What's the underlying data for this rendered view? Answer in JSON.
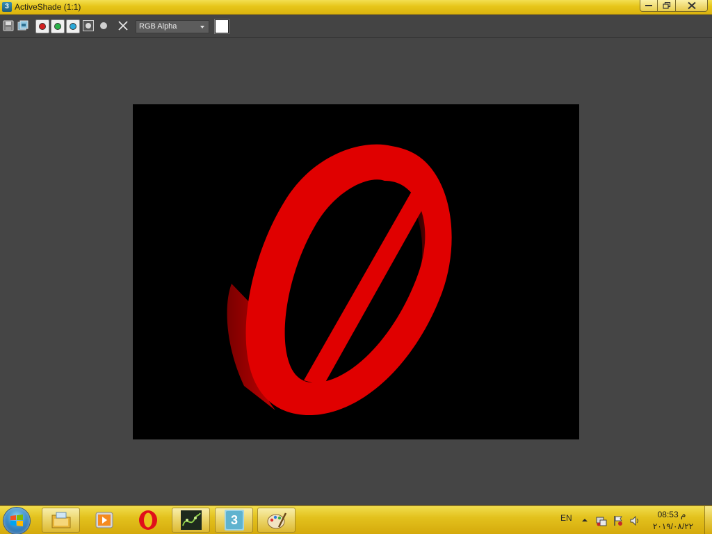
{
  "window": {
    "title": "ActiveShade (1:1)",
    "app_icon_label": "3"
  },
  "toolbar": {
    "icons": [
      "save-icon",
      "copy-image-icon",
      "red-channel-icon",
      "green-channel-icon",
      "blue-channel-icon",
      "alpha-channel-icon",
      "monochrome-icon",
      "clear-icon"
    ],
    "channel_select_value": "RGB Alpha",
    "swatch_color": "#ffffff"
  },
  "render": {
    "background": "#000000",
    "object_color": "#e00000",
    "object": "red no-entry ring with diagonal bar"
  },
  "taskbar": {
    "apps": [
      "windows-explorer-icon",
      "media-player-icon",
      "opera-icon",
      "graph-app-icon",
      "3ds-max-icon",
      "paint-icon"
    ],
    "max_label": "3",
    "tray_lang": "EN",
    "clock_time": "08:53 م",
    "clock_date": "٢٠١٩/٠٨/٢٢"
  },
  "colors": {
    "title_gradient_top": "#f3df52",
    "title_gradient_bottom": "#dbb30e",
    "toolbar_bg": "#444444",
    "viewport_bg": "#454545"
  }
}
